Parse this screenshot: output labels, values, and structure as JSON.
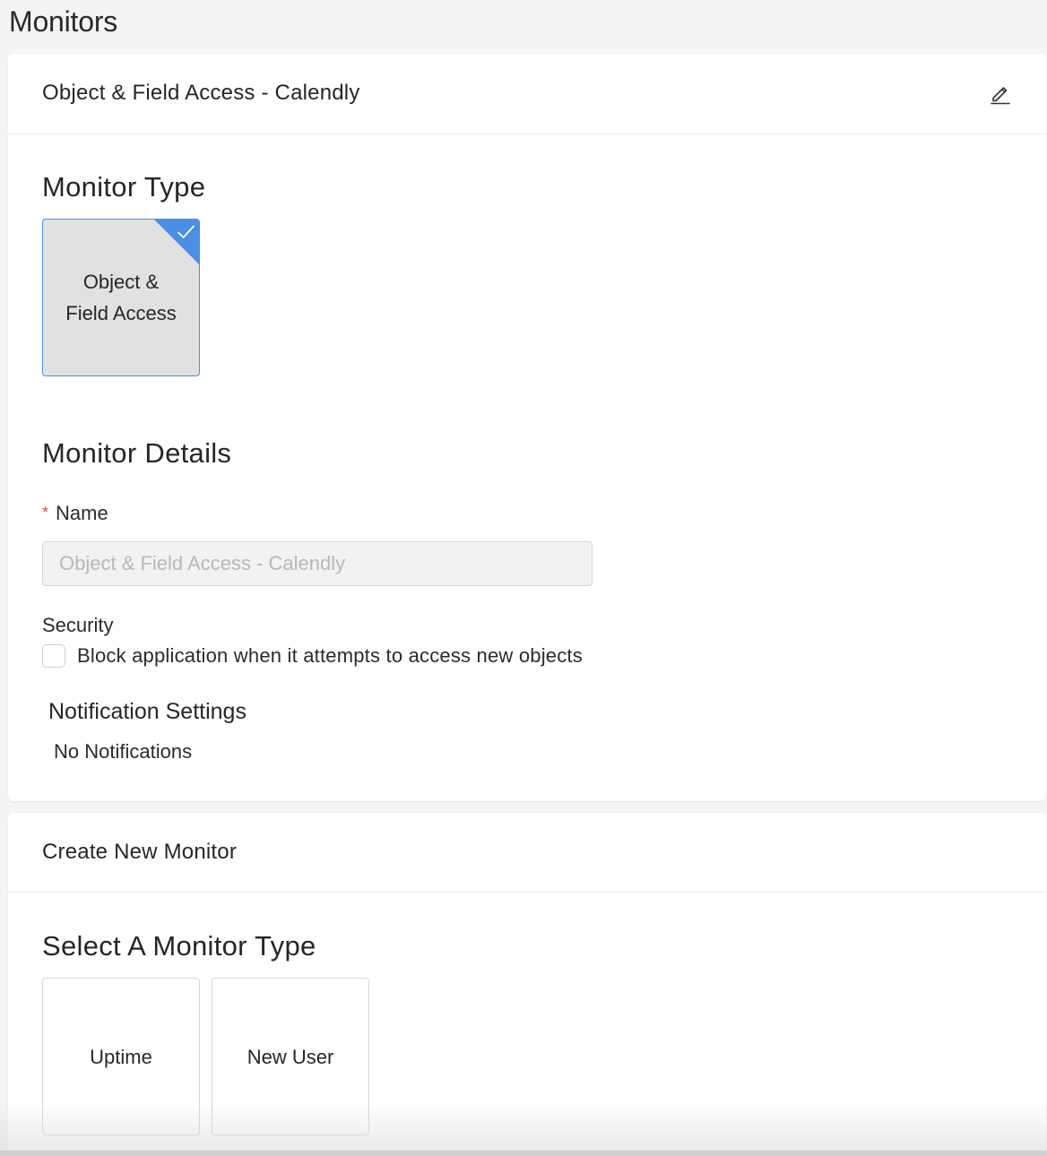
{
  "page": {
    "title": "Monitors"
  },
  "monitor_card": {
    "header_title": "Object & Field Access - Calendly",
    "edit_icon": "pencil-edit-icon",
    "monitor_type": {
      "title": "Monitor Type",
      "selected_tile": {
        "label": "Object & Field Access",
        "selected": true,
        "icon": "checkmark-icon"
      }
    },
    "details": {
      "title": "Monitor Details",
      "name_label": "Name",
      "name_required_mark": "*",
      "name_placeholder": "Object & Field Access - Calendly",
      "security_label": "Security",
      "block_checkbox_label": "Block application when it attempts to access new objects",
      "block_checked": false
    },
    "notifications": {
      "title": "Notification Settings",
      "value": "No Notifications"
    }
  },
  "create_card": {
    "header_title": "Create New Monitor",
    "select_title": "Select A Monitor Type",
    "types": [
      {
        "label": "Uptime"
      },
      {
        "label": "New User"
      }
    ]
  },
  "colors": {
    "accent": "#4a8fe3",
    "required": "#e04848",
    "selected_tile_bg": "#e1e1e1",
    "page_bg": "#f4f4f4"
  }
}
